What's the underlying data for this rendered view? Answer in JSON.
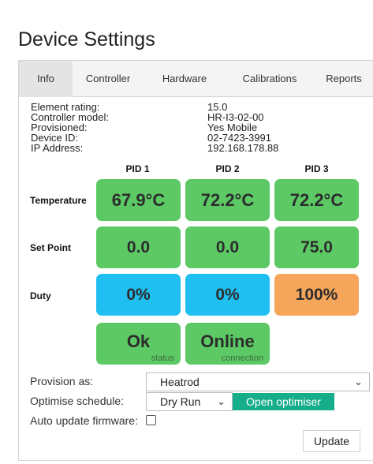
{
  "title": "Device Settings",
  "tabs": [
    "Info",
    "Controller",
    "Hardware",
    "Calibrations",
    "Reports"
  ],
  "info": {
    "labels": [
      "Element rating:",
      "Controller model:",
      "Provisioned:",
      "Device ID:",
      "IP Address:"
    ],
    "values": [
      "15.0",
      "HR-I3-02-00",
      "Yes Mobile",
      "02-7423-3991",
      "192.168.178.88"
    ]
  },
  "pids": [
    "PID 1",
    "PID 2",
    "PID 3"
  ],
  "rows": {
    "temperature": {
      "label": "Temperature",
      "values": [
        "67.9°C",
        "72.2°C",
        "72.2°C"
      ]
    },
    "set_point": {
      "label": "Set Point",
      "values": [
        "0.0",
        "0.0",
        "75.0"
      ]
    },
    "duty": {
      "label": "Duty",
      "values": [
        "0%",
        "0%",
        "100%"
      ]
    }
  },
  "status": {
    "value": "Ok",
    "caption": "status"
  },
  "connection": {
    "value": "Online",
    "caption": "connection"
  },
  "form": {
    "provision_label": "Provision as:",
    "provision_value": "Heatrod",
    "optimise_label": "Optimise schedule:",
    "optimise_value": "Dry Run",
    "optimiser_button": "Open optimiser",
    "auto_update_label": "Auto update firmware:",
    "auto_update_checked": false,
    "update_button": "Update"
  },
  "colors": {
    "tile_green": "#5cc965",
    "tile_blue": "#1fbff1",
    "tile_orange": "#f6a65b",
    "optimiser_button": "#16ad8b"
  }
}
